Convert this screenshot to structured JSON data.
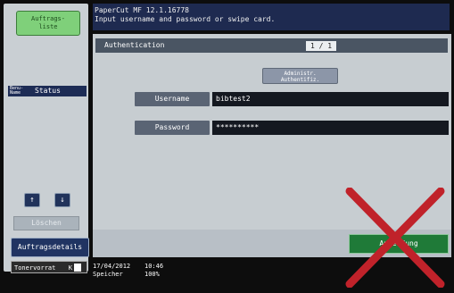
{
  "left_panel": {
    "job_list_button": "Auftrags-\nliste",
    "table_header_small": "Benu-\nName",
    "table_header_status": "Status",
    "up_arrow": "↑",
    "down_arrow": "↓",
    "delete_button": "Löschen",
    "job_details_button": "Auftragsdetails",
    "toner_label": "Tonervorrat",
    "toner_marker": "K"
  },
  "header": {
    "line1": "PaperCut MF 12.1.16778",
    "line2": "Input username and password or swipe card."
  },
  "dialog": {
    "title": "Authentication",
    "page_indicator": "1 / 1",
    "admin_button": "Administr.\nAuthentifiz.",
    "username_label": "Username",
    "username_value": "bibtest2",
    "password_label": "Password",
    "password_value": "**********",
    "ok_button": "Anmeldung"
  },
  "status_bar": {
    "date": "17/04/2012",
    "time": "10:46",
    "memory_label": "Speicher",
    "memory_value": "100%"
  },
  "overlay": {
    "red_x_color": "#c0222a"
  }
}
